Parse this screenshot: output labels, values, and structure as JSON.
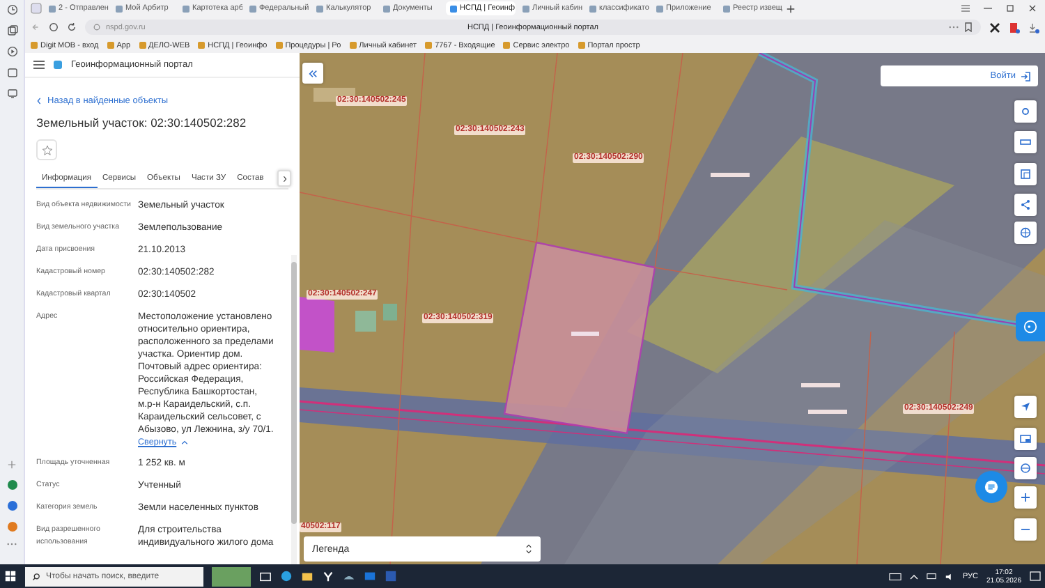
{
  "browser": {
    "tabs": [
      {
        "label": "2 - Отправлен",
        "selected": false
      },
      {
        "label": "Мой Арбитр",
        "selected": false
      },
      {
        "label": "Картотека арб",
        "selected": false
      },
      {
        "label": "Федеральный",
        "selected": false
      },
      {
        "label": "Калькулятор",
        "selected": false
      },
      {
        "label": "Документы",
        "selected": false
      },
      {
        "label": "НСПД | Геоинф",
        "selected": true
      },
      {
        "label": "Личный кабин",
        "selected": false
      },
      {
        "label": "классификато",
        "selected": false
      },
      {
        "label": "Приложение",
        "selected": false
      },
      {
        "label": "Реестр извещ",
        "selected": false
      }
    ],
    "address": "nspd.gov.ru",
    "page_title": "НСПД | Геоинформационный портал",
    "bookmarks": [
      "Digit МОВ - вход",
      "App",
      "ДЕЛО-WEB",
      "НСПД | Геоинфо",
      "Процедуры | Ро",
      "Личный кабинет",
      "7767 - Входящие",
      "Сервис электро",
      "Портал простр"
    ]
  },
  "portal": {
    "title": "Геоинформационный портал"
  },
  "panel": {
    "back_link": "Назад в найденные объекты",
    "heading": "Земельный участок: 02:30:140502:282",
    "favorite": false,
    "tabs": [
      {
        "label": "Информация",
        "selected": true
      },
      {
        "label": "Сервисы",
        "selected": false
      },
      {
        "label": "Объекты",
        "selected": false
      },
      {
        "label": "Части ЗУ",
        "selected": false
      },
      {
        "label": "Состав",
        "selected": false
      }
    ],
    "fields": [
      {
        "label": "Вид объекта недвижимости",
        "value": "Земельный участок"
      },
      {
        "label": "Вид земельного участка",
        "value": "Землепользование"
      },
      {
        "label": "Дата присвоения",
        "value": "21.10.2013"
      },
      {
        "label": "Кадастровый номер",
        "value": "02:30:140502:282"
      },
      {
        "label": "Кадастровый квартал",
        "value": "02:30:140502"
      },
      {
        "label": "Адрес",
        "value": "Местоположение установлено относительно ориентира, расположенного за пределами участка. Ориентир дом. Почтовый адрес ориентира: Российская Федерация, Республика Башкортостан, м.р-н Караидельский, с.п. Караидельский сельсовет, с Абызово, ул Лежнина, з/у 70/1.",
        "toggle": "Свернуть"
      },
      {
        "label": "Площадь уточненная",
        "value": "1 252 кв. м"
      },
      {
        "label": "Статус",
        "value": "Учтенный"
      },
      {
        "label": "Категория земель",
        "value": "Земли населенных пунктов"
      },
      {
        "label": "Вид разрешенного использования",
        "value": "Для строительства индивидуального жилого дома"
      }
    ]
  },
  "map": {
    "login": "Войти",
    "legend": "Легенда",
    "parcel_labels": [
      "02:30:140502:245",
      "02:30:140502:243",
      "02:30:140502:290",
      "02:30:140502:247",
      "02:30:140502:319",
      "02:30:140502:249",
      "40502:117"
    ]
  },
  "taskbar": {
    "search_placeholder": "Чтобы начать поиск, введите",
    "language": "РУС",
    "time": "17:02",
    "date": "21.05.2026"
  }
}
